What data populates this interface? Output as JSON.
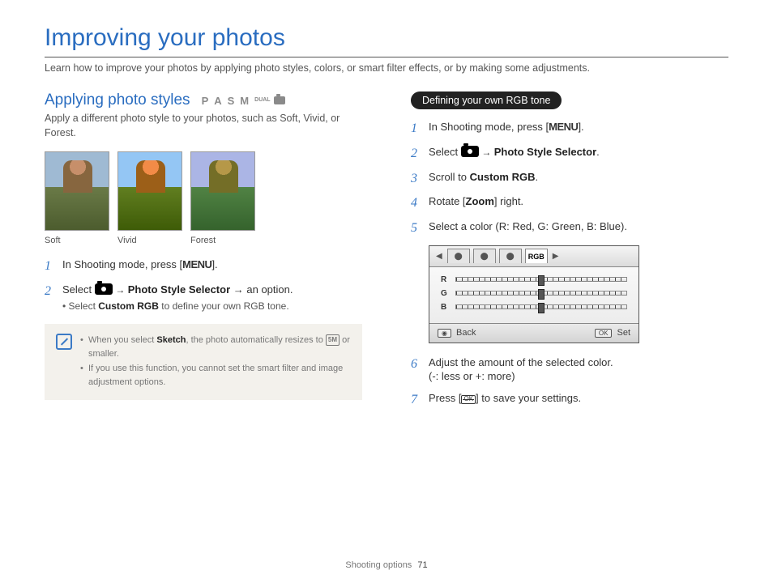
{
  "page": {
    "title": "Improving your photos",
    "intro": "Learn how to improve your photos by applying photo styles, colors, or smart filter effects, or by making some adjustments."
  },
  "left": {
    "heading": "Applying photo styles",
    "modes": {
      "p": "P",
      "a": "A",
      "s": "S",
      "m": "M",
      "dual": "DUAL"
    },
    "desc": "Apply a different photo style to your photos, such as Soft, Vivid, or Forest.",
    "thumbs": [
      {
        "caption": "Soft"
      },
      {
        "caption": "Vivid"
      },
      {
        "caption": "Forest"
      }
    ],
    "steps": {
      "s1_a": "In Shooting mode, press [",
      "s1_menu": "MENU",
      "s1_b": "].",
      "s2_a": "Select ",
      "s2_b": "Photo Style Selector",
      "s2_c": " → an option.",
      "s2_sub_a": "Select ",
      "s2_sub_b": "Custom RGB",
      "s2_sub_c": " to define your own RGB tone."
    },
    "note": {
      "li1_a": "When you select ",
      "li1_b": "Sketch",
      "li1_c": ", the photo automatically resizes to ",
      "li1_size": "5M",
      "li1_d": " or smaller.",
      "li2": "If you use this function, you cannot set the smart filter and image adjustment options."
    }
  },
  "right": {
    "pill": "Defining your own RGB tone",
    "steps": {
      "s1_a": "In Shooting mode, press [",
      "s1_menu": "MENU",
      "s1_b": "].",
      "s2_a": "Select ",
      "s2_b": "Photo Style Selector",
      "s2_c": ".",
      "s3_a": "Scroll to ",
      "s3_b": "Custom RGB",
      "s3_c": ".",
      "s4_a": "Rotate [",
      "s4_b": "Zoom",
      "s4_c": "] right.",
      "s5": "Select a color (R: Red, G: Green, B: Blue).",
      "s6_a": "Adjust the amount of the selected color.",
      "s6_b": "(-: less or +: more)",
      "s7_a": "Press [",
      "s7_b": "] to save your settings."
    },
    "panel": {
      "tab_active": "RGB",
      "r": "R",
      "g": "G",
      "b": "B",
      "back": "Back",
      "ok": "OK",
      "set": "Set"
    }
  },
  "footer": {
    "section": "Shooting options",
    "page": "71"
  }
}
